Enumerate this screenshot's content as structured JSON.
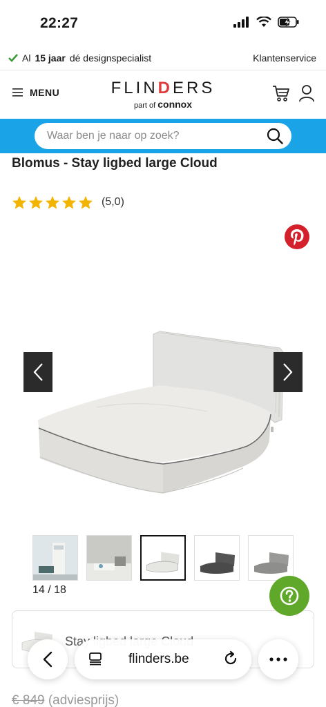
{
  "status_bar": {
    "time": "22:27"
  },
  "info_bar": {
    "prefix": "Al",
    "years": "15 jaar",
    "suffix": "dé designspecialist",
    "service_link": "Klantenservice"
  },
  "header": {
    "menu_label": "MENU",
    "logo_before": "FLIN",
    "logo_d": "D",
    "logo_after": "ERS",
    "logo_sub_prefix": "part of",
    "logo_sub_brand": "connox"
  },
  "search": {
    "placeholder": "Waar ben je naar op zoek?"
  },
  "product": {
    "title": "Blomus - Stay ligbed large Cloud",
    "rating_stars": 5,
    "rating_text": "(5,0)",
    "image_counter": "14 / 18",
    "variant_name": "Stay ligbed large Cloud",
    "price_old": "€ 849",
    "price_note": "(adviesprijs)"
  },
  "browser": {
    "url": "flinders.be"
  },
  "colors": {
    "accent_blue": "#1aa3e6",
    "star": "#f2b400",
    "help_green": "#5fa82a",
    "pinterest": "#d4202a",
    "check_green": "#3a9a3a"
  }
}
